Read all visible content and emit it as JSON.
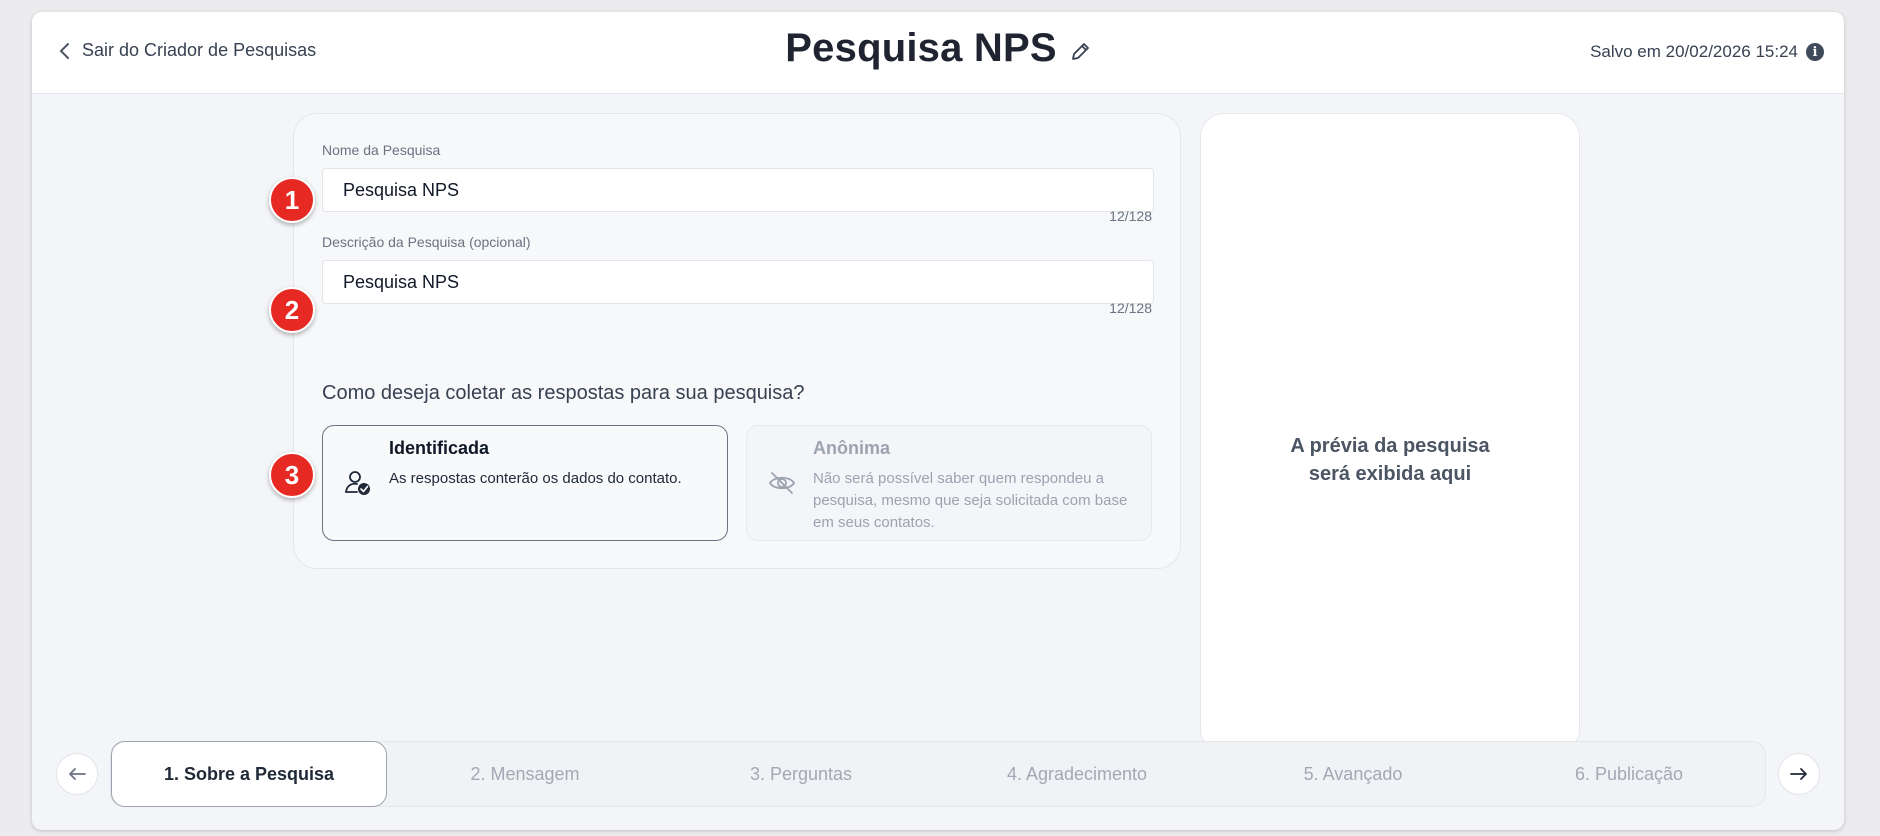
{
  "header": {
    "back_label": "Sair do Criador de Pesquisas",
    "title": "Pesquisa NPS",
    "saved_text": "Salvo em 20/02/2026 15:24",
    "info_glyph": "i"
  },
  "form": {
    "name_label": "Nome da Pesquisa",
    "name_value": "Pesquisa NPS",
    "name_counter": "12/128",
    "desc_label": "Descrição da Pesquisa (opcional)",
    "desc_value": "Pesquisa NPS",
    "desc_counter": "12/128",
    "question": "Como deseja coletar as respostas para sua pesquisa?",
    "options": [
      {
        "title": "Identificada",
        "description": "As respostas conterão os dados do contato.",
        "icon": "user-check-icon",
        "selected": true
      },
      {
        "title": "Anônima",
        "description": "Não será possível saber quem respondeu a pesquisa, mesmo que seja solicitada com base em seus contatos.",
        "icon": "eye-off-icon",
        "selected": false
      }
    ]
  },
  "markers": [
    "1",
    "2",
    "3"
  ],
  "preview": {
    "line1": "A prévia da pesquisa",
    "line2": "será exibida aqui"
  },
  "steps": [
    "1. Sobre a Pesquisa",
    "2. Mensagem",
    "3. Perguntas",
    "4. Agradecimento",
    "5. Avançado",
    "6. Publicação"
  ],
  "active_step": 0,
  "colors": {
    "marker": "#e62a23",
    "background": "#f4f5f8",
    "text_dark": "#1f2430"
  }
}
